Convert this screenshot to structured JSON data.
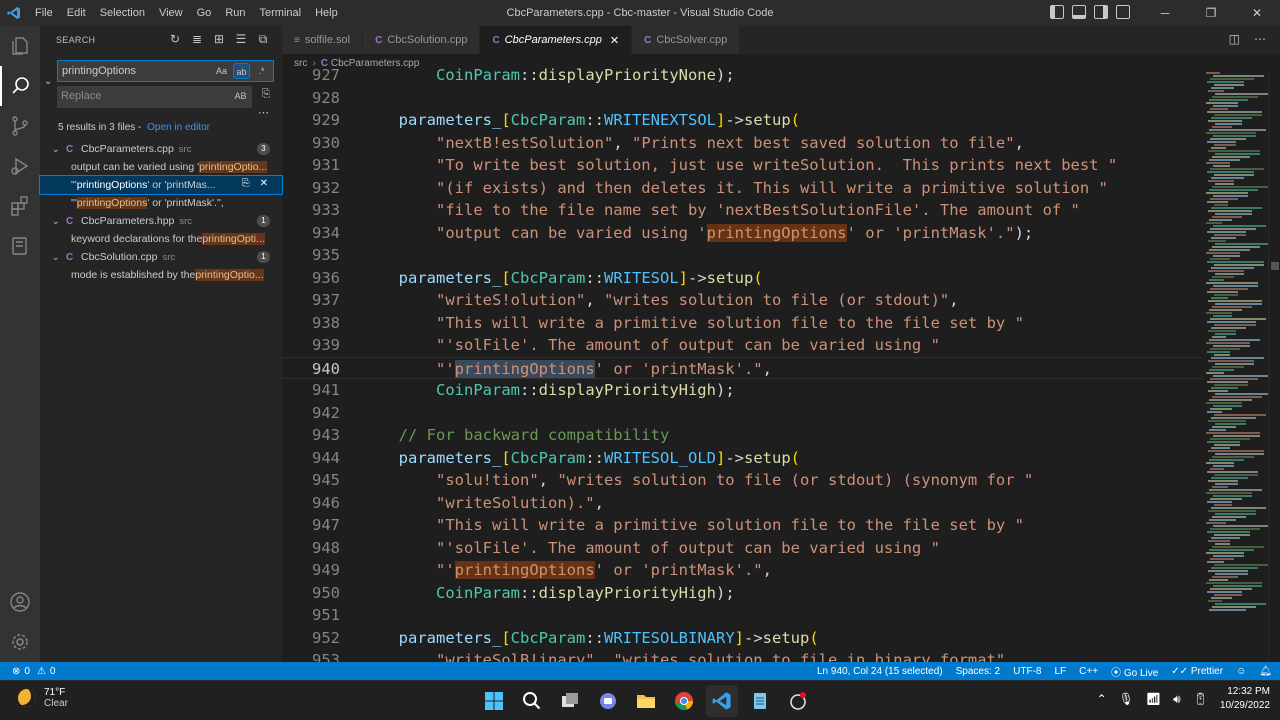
{
  "window": {
    "title": "CbcParameters.cpp - Cbc-master - Visual Studio Code",
    "menu": [
      "File",
      "Edit",
      "Selection",
      "View",
      "Go",
      "Run",
      "Terminal",
      "Help"
    ]
  },
  "sidebar": {
    "header": "SEARCH",
    "search_value": "printingOptions",
    "search_opts": [
      "Aa",
      "ab",
      ".*"
    ],
    "replace_placeholder": "Replace",
    "preserve_case": "AB",
    "summary": "5 results in 3 files -",
    "open_in_editor": "Open in editor",
    "files": [
      {
        "name": "CbcParameters.cpp",
        "path": "src",
        "count": "3",
        "matches": [
          {
            "pre": "output can be varied using '",
            "hit": "printingOptio...",
            "post": ""
          },
          {
            "pre": "\"'",
            "hit": "printingOptions",
            "post": "' or 'printMas..."
          },
          {
            "pre": "\"'",
            "hit": "printingOptions",
            "post": "' or 'printMask'.\","
          }
        ]
      },
      {
        "name": "CbcParameters.hpp",
        "path": "src",
        "count": "1",
        "matches": [
          {
            "pre": "keyword declarations for the ",
            "hit": "printingOpti...",
            "post": ""
          }
        ]
      },
      {
        "name": "CbcSolution.cpp",
        "path": "src",
        "count": "1",
        "matches": [
          {
            "pre": "mode is established by the ",
            "hit": "printingOptio...",
            "post": ""
          }
        ]
      }
    ]
  },
  "tabs": [
    {
      "label": "solfile.sol",
      "icon": "sol"
    },
    {
      "label": "CbcSolution.cpp",
      "icon": "cpp"
    },
    {
      "label": "CbcParameters.cpp",
      "icon": "cpp",
      "active": true
    },
    {
      "label": "CbcSolver.cpp",
      "icon": "cpp"
    }
  ],
  "breadcrumb": [
    "src",
    "CbcParameters.cpp"
  ],
  "editor": {
    "lines": [
      {
        "n": "927",
        "tokens": [
          [
            "      ",
            ""
          ],
          [
            "CoinParam",
            "type"
          ],
          [
            "::",
            "op"
          ],
          [
            "displayPriorityNone",
            "fn"
          ],
          [
            ");",
            "op"
          ]
        ]
      },
      {
        "n": "928",
        "tokens": []
      },
      {
        "n": "929",
        "tokens": [
          [
            "  ",
            ""
          ],
          [
            "parameters_",
            "var"
          ],
          [
            "[",
            "br1"
          ],
          [
            "CbcParam",
            "type"
          ],
          [
            "::",
            "op"
          ],
          [
            "WRITENEXTSOL",
            "const"
          ],
          [
            "]",
            "br1"
          ],
          [
            "->",
            "op"
          ],
          [
            "setup",
            "fn"
          ],
          [
            "(",
            "br1"
          ]
        ]
      },
      {
        "n": "930",
        "tokens": [
          [
            "      ",
            ""
          ],
          [
            "\"nextB!estSolution\"",
            "str"
          ],
          [
            ", ",
            "op"
          ],
          [
            "\"Prints next best saved solution to file\"",
            "str"
          ],
          [
            ",",
            "op"
          ]
        ]
      },
      {
        "n": "931",
        "tokens": [
          [
            "      ",
            ""
          ],
          [
            "\"To write best solution, just use writeSolution.  This prints next best \"",
            "str"
          ]
        ]
      },
      {
        "n": "932",
        "tokens": [
          [
            "      ",
            ""
          ],
          [
            "\"(if exists) and then deletes it. This will write a primitive solution \"",
            "str"
          ]
        ]
      },
      {
        "n": "933",
        "tokens": [
          [
            "      ",
            ""
          ],
          [
            "\"file to the file name set by 'nextBestSolutionFile'. The amount of \"",
            "str"
          ]
        ]
      },
      {
        "n": "934",
        "tokens": [
          [
            "      ",
            ""
          ],
          [
            "\"output can be varied using '",
            "str"
          ],
          [
            "printingOptions",
            "strhl"
          ],
          [
            "' or 'printMask'.\"",
            "str"
          ],
          [
            ");",
            "op"
          ]
        ]
      },
      {
        "n": "935",
        "tokens": []
      },
      {
        "n": "936",
        "tokens": [
          [
            "  ",
            ""
          ],
          [
            "parameters_",
            "var"
          ],
          [
            "[",
            "br1"
          ],
          [
            "CbcParam",
            "type"
          ],
          [
            "::",
            "op"
          ],
          [
            "WRITESOL",
            "const"
          ],
          [
            "]",
            "br1"
          ],
          [
            "->",
            "op"
          ],
          [
            "setup",
            "fn"
          ],
          [
            "(",
            "br1"
          ]
        ]
      },
      {
        "n": "937",
        "tokens": [
          [
            "      ",
            ""
          ],
          [
            "\"writeS!olution\"",
            "str"
          ],
          [
            ", ",
            "op"
          ],
          [
            "\"writes solution to file (or stdout)\"",
            "str"
          ],
          [
            ",",
            "op"
          ]
        ]
      },
      {
        "n": "938",
        "tokens": [
          [
            "      ",
            ""
          ],
          [
            "\"This will write a primitive solution file to the file set by \"",
            "str"
          ]
        ]
      },
      {
        "n": "939",
        "tokens": [
          [
            "      ",
            ""
          ],
          [
            "\"'solFile'. The amount of output can be varied using \"",
            "str"
          ]
        ]
      },
      {
        "n": "940",
        "tokens": [
          [
            "      ",
            ""
          ],
          [
            "\"'",
            "str"
          ],
          [
            "printingOptions",
            "strsel"
          ],
          [
            "' or 'printMask'.\"",
            "str"
          ],
          [
            ",",
            "op"
          ]
        ],
        "current": true
      },
      {
        "n": "941",
        "tokens": [
          [
            "      ",
            ""
          ],
          [
            "CoinParam",
            "type"
          ],
          [
            "::",
            "op"
          ],
          [
            "displayPriorityHigh",
            "fn"
          ],
          [
            ");",
            "op"
          ]
        ]
      },
      {
        "n": "942",
        "tokens": []
      },
      {
        "n": "943",
        "tokens": [
          [
            "  ",
            ""
          ],
          [
            "// For backward compatibility",
            "cm"
          ]
        ]
      },
      {
        "n": "944",
        "tokens": [
          [
            "  ",
            ""
          ],
          [
            "parameters_",
            "var"
          ],
          [
            "[",
            "br1"
          ],
          [
            "CbcParam",
            "type"
          ],
          [
            "::",
            "op"
          ],
          [
            "WRITESOL_OLD",
            "const"
          ],
          [
            "]",
            "br1"
          ],
          [
            "->",
            "op"
          ],
          [
            "setup",
            "fn"
          ],
          [
            "(",
            "br1"
          ]
        ]
      },
      {
        "n": "945",
        "tokens": [
          [
            "      ",
            ""
          ],
          [
            "\"solu!tion\"",
            "str"
          ],
          [
            ", ",
            "op"
          ],
          [
            "\"writes solution to file (or stdout) (synonym for \"",
            "str"
          ]
        ]
      },
      {
        "n": "946",
        "tokens": [
          [
            "      ",
            ""
          ],
          [
            "\"writeSolution).\"",
            "str"
          ],
          [
            ",",
            "op"
          ]
        ]
      },
      {
        "n": "947",
        "tokens": [
          [
            "      ",
            ""
          ],
          [
            "\"This will write a primitive solution file to the file set by \"",
            "str"
          ]
        ]
      },
      {
        "n": "948",
        "tokens": [
          [
            "      ",
            ""
          ],
          [
            "\"'solFile'. The amount of output can be varied using \"",
            "str"
          ]
        ]
      },
      {
        "n": "949",
        "tokens": [
          [
            "      ",
            ""
          ],
          [
            "\"'",
            "str"
          ],
          [
            "printingOptions",
            "strhl"
          ],
          [
            "' or 'printMask'.\"",
            "str"
          ],
          [
            ",",
            "op"
          ]
        ]
      },
      {
        "n": "950",
        "tokens": [
          [
            "      ",
            ""
          ],
          [
            "CoinParam",
            "type"
          ],
          [
            "::",
            "op"
          ],
          [
            "displayPriorityHigh",
            "fn"
          ],
          [
            ");",
            "op"
          ]
        ]
      },
      {
        "n": "951",
        "tokens": []
      },
      {
        "n": "952",
        "tokens": [
          [
            "  ",
            ""
          ],
          [
            "parameters_",
            "var"
          ],
          [
            "[",
            "br1"
          ],
          [
            "CbcParam",
            "type"
          ],
          [
            "::",
            "op"
          ],
          [
            "WRITESOLBINARY",
            "const"
          ],
          [
            "]",
            "br1"
          ],
          [
            "->",
            "op"
          ],
          [
            "setup",
            "fn"
          ],
          [
            "(",
            "br1"
          ]
        ]
      },
      {
        "n": "953",
        "tokens": [
          [
            "      ",
            ""
          ],
          [
            "\"writeSolB!inary\"",
            "str"
          ],
          [
            ", ",
            "op"
          ],
          [
            "\"writes solution to file in binary format\"",
            "str"
          ],
          [
            ",",
            "op"
          ]
        ]
      }
    ]
  },
  "statusbar": {
    "errors": "0",
    "warnings": "0",
    "position": "Ln 940, Col 24 (15 selected)",
    "spaces": "Spaces: 2",
    "encoding": "UTF-8",
    "eol": "LF",
    "language": "C++",
    "golive": "Go Live",
    "prettier": "Prettier"
  },
  "taskbar": {
    "temp": "71°F",
    "condition": "Clear",
    "time": "12:32 PM",
    "date": "10/29/2022"
  },
  "colors": {
    "accent": "#007acc",
    "match_highlight": "#ea5c00"
  }
}
